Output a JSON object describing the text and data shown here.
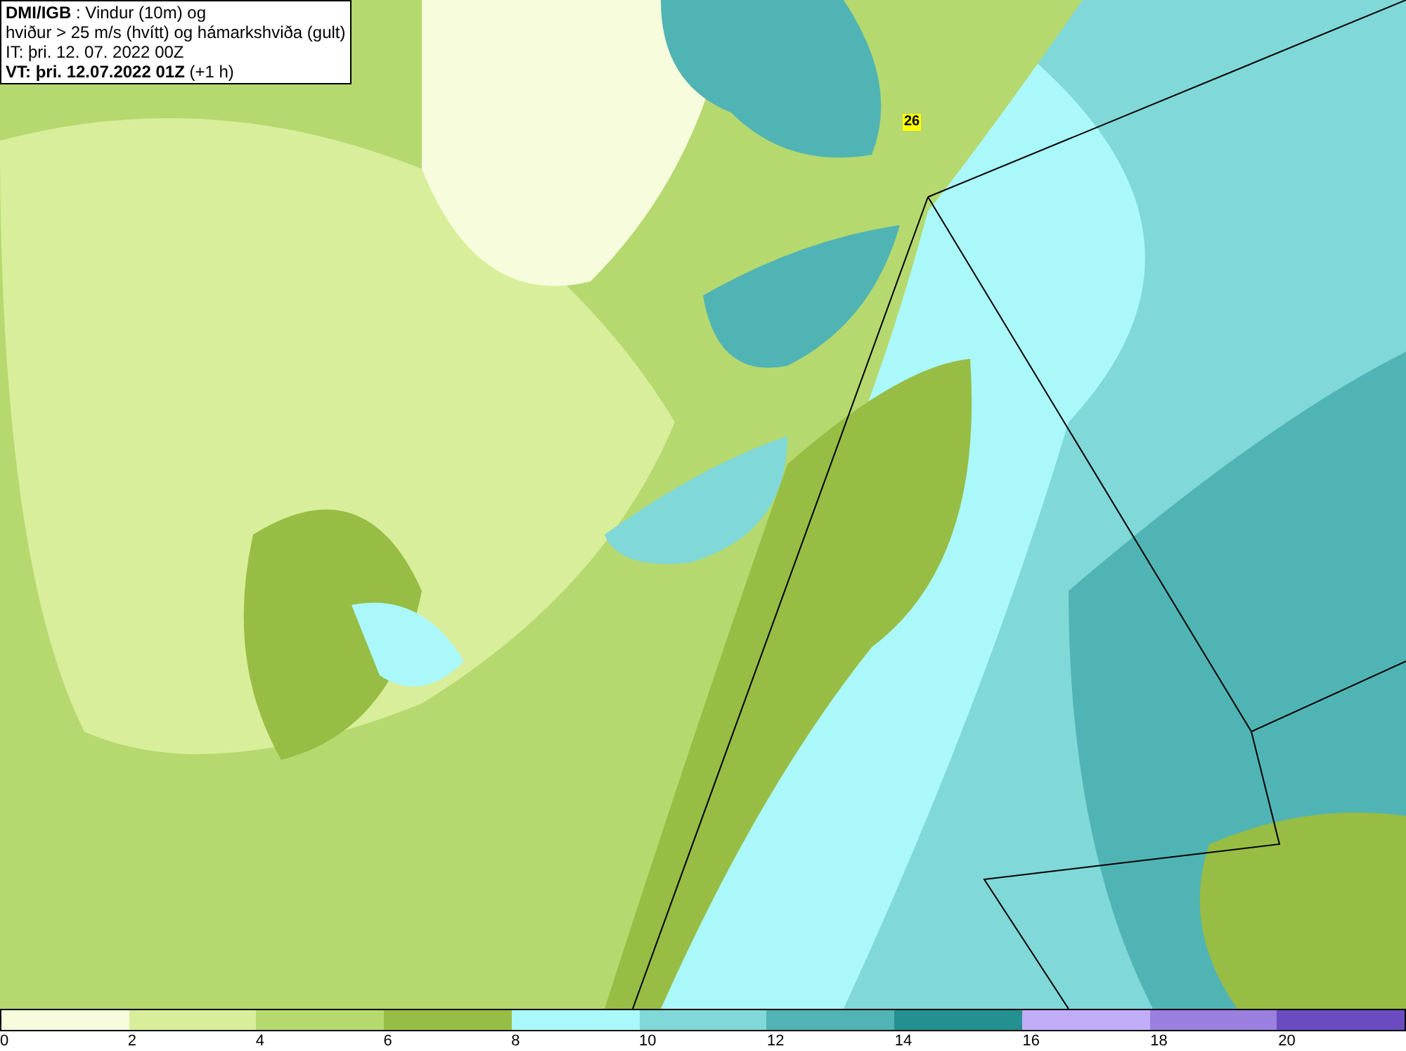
{
  "title_box": {
    "lines": [
      "**DMI/IGB** : Vindur (10m) og",
      "hviður > 25 m/s (hvítt) og hámarkshviða (gult)",
      "IT: þri. 12. 07. 2022 00Z",
      "**VT: þri. 12.07.2022 01Z** (+1 h)"
    ]
  },
  "map": {
    "gust_label": "26"
  },
  "legend": {
    "bins": [
      {
        "color": "#f7fcdc"
      },
      {
        "color": "#d8ee9a"
      },
      {
        "color": "#b5d96f"
      },
      {
        "color": "#97bd44"
      },
      {
        "color": "#aaf8fa"
      },
      {
        "color": "#80d8d8"
      },
      {
        "color": "#50b4b4"
      },
      {
        "color": "#249090"
      },
      {
        "color": "#c2aef8"
      },
      {
        "color": "#9a7fe0"
      },
      {
        "color": "#6a4cc0"
      }
    ],
    "ticks": [
      "0",
      "2",
      "4",
      "6",
      "8",
      "10",
      "12",
      "14",
      "16",
      "18",
      "20"
    ]
  }
}
